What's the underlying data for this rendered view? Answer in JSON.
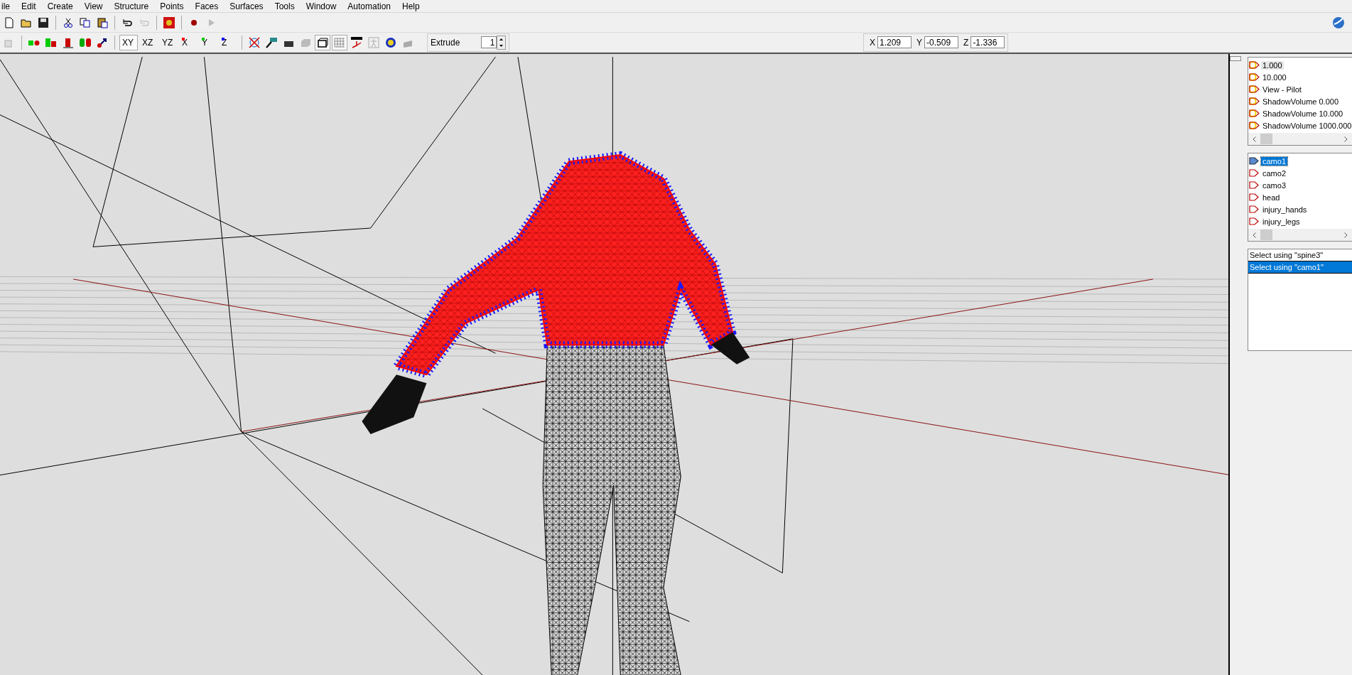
{
  "menu": [
    "ile",
    "Edit",
    "Create",
    "View",
    "Structure",
    "Points",
    "Faces",
    "Surfaces",
    "Tools",
    "Window",
    "Automation",
    "Help"
  ],
  "axis_buttons": [
    {
      "label": "XY",
      "selected": true
    },
    {
      "label": "XZ",
      "selected": false
    },
    {
      "label": "YZ",
      "selected": false
    },
    {
      "label": "X",
      "selected": false,
      "color": "#ff0000"
    },
    {
      "label": "Y",
      "selected": false,
      "color": "#00cc00"
    },
    {
      "label": "Z",
      "selected": false,
      "color": "#0000ff"
    }
  ],
  "extrude": {
    "label": "Extrude",
    "value": "1"
  },
  "coordinates": [
    {
      "axis": "X",
      "value": "1.209"
    },
    {
      "axis": "Y",
      "value": "-0.509"
    },
    {
      "axis": "Z",
      "value": "-1.336"
    }
  ],
  "lods": [
    {
      "label": "1.000",
      "selected": true
    },
    {
      "label": "10.000",
      "selected": false
    },
    {
      "label": "View - Pilot",
      "selected": false
    },
    {
      "label": "ShadowVolume 0.000",
      "selected": false
    },
    {
      "label": "ShadowVolume 10.000",
      "selected": false
    },
    {
      "label": "ShadowVolume 1000.000",
      "selected": false
    }
  ],
  "selections": [
    {
      "label": "camo1",
      "selected": true
    },
    {
      "label": "camo2",
      "selected": false
    },
    {
      "label": "camo3",
      "selected": false
    },
    {
      "label": "head",
      "selected": false
    },
    {
      "label": "injury_hands",
      "selected": false
    },
    {
      "label": "injury_legs",
      "selected": false
    }
  ],
  "named_selections": [
    {
      "label": "Select using \"spine3\"",
      "selected": false
    },
    {
      "label": "Select using \"camo1\"",
      "selected": true
    }
  ]
}
